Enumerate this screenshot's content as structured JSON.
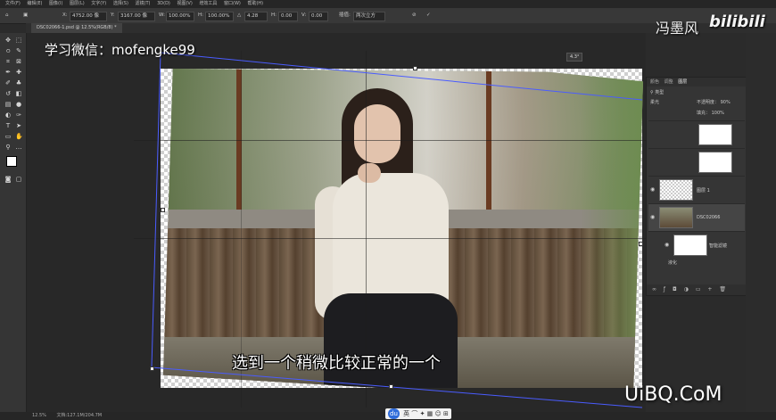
{
  "menubar": {
    "items": [
      "文件(F)",
      "编辑(E)",
      "图像(I)",
      "图层(L)",
      "文字(Y)",
      "选择(S)",
      "滤镜(T)",
      "3D(D)",
      "视图(V)",
      "增效工具",
      "窗口(W)",
      "帮助(H)"
    ]
  },
  "options": {
    "x": "4752.00 像",
    "y": "3167.00 像",
    "w": "100.00%",
    "h": "100.00%",
    "angle": "4.28",
    "h_skew": "0.00",
    "v_skew": "0.00",
    "interp": "两次立方"
  },
  "document": {
    "tab": "DSC02066-1.psd @ 12.5%(RGB/8) *"
  },
  "canvas": {
    "angle_readout": "4.3°"
  },
  "overlays": {
    "watermark": "学习微信：mofengke99",
    "subtitle": "选到一个稍微比较正常的一个",
    "uploader": "冯墨风",
    "brand": "bilibili",
    "site": "UiBQ.CoM"
  },
  "layers_panel": {
    "tabs": [
      "颜色",
      "调整",
      "图层"
    ],
    "active_tab": "图层",
    "kind_filter": "类型",
    "blend_mode": "柔光",
    "opacity_label": "不透明度：",
    "opacity": "90%",
    "fill_label": "填充：",
    "fill": "100%",
    "layers": [
      {
        "name": "",
        "type": "adjustment"
      },
      {
        "name": "",
        "type": "adjustment"
      },
      {
        "name": "图层 1",
        "type": "empty"
      },
      {
        "name": "DSC02066",
        "type": "photo"
      },
      {
        "name": "智能滤镜",
        "type": "filter-mask"
      },
      {
        "name": "液化",
        "type": "filter"
      }
    ]
  },
  "statusbar": {
    "zoom": "12.5%",
    "docsize": "文档:127.1M/204.7M"
  },
  "ime": {
    "label": "英"
  }
}
